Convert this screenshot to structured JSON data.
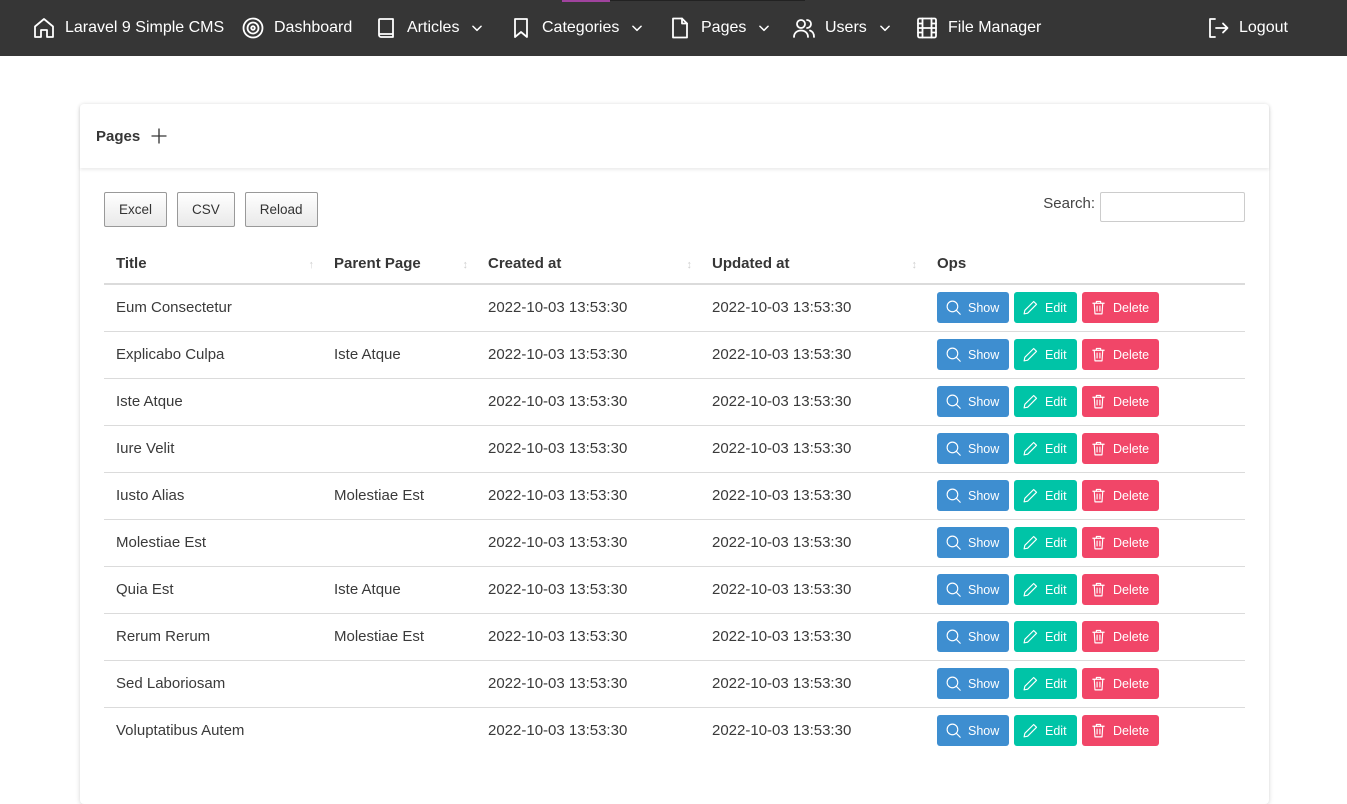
{
  "navbar": {
    "brand": "Laravel 9 Simple CMS",
    "items": [
      {
        "label": "Dashboard",
        "icon": "target-icon",
        "dropdown": false
      },
      {
        "label": "Articles",
        "icon": "book-icon",
        "dropdown": true
      },
      {
        "label": "Categories",
        "icon": "bookmark-icon",
        "dropdown": true
      },
      {
        "label": "Pages",
        "icon": "file-icon",
        "dropdown": true
      },
      {
        "label": "Users",
        "icon": "users-icon",
        "dropdown": true
      },
      {
        "label": "File Manager",
        "icon": "film-icon",
        "dropdown": false
      }
    ],
    "logout": "Logout",
    "bg_color": "#363636",
    "accent_color": "#a0439e"
  },
  "card": {
    "title": "Pages",
    "add_icon": "plus-icon"
  },
  "toolbar": {
    "excel": "Excel",
    "csv": "CSV",
    "reload": "Reload"
  },
  "search": {
    "label": "Search:",
    "value": "",
    "placeholder": ""
  },
  "table": {
    "columns": [
      "Title",
      "Parent Page",
      "Created at",
      "Updated at",
      "Ops"
    ],
    "rows": [
      {
        "title": "Eum Consectetur",
        "parent": "",
        "created": "2022-10-03 13:53:30",
        "updated": "2022-10-03 13:53:30"
      },
      {
        "title": "Explicabo Culpa",
        "parent": "Iste Atque",
        "created": "2022-10-03 13:53:30",
        "updated": "2022-10-03 13:53:30"
      },
      {
        "title": "Iste Atque",
        "parent": "",
        "created": "2022-10-03 13:53:30",
        "updated": "2022-10-03 13:53:30"
      },
      {
        "title": "Iure Velit",
        "parent": "",
        "created": "2022-10-03 13:53:30",
        "updated": "2022-10-03 13:53:30"
      },
      {
        "title": "Iusto Alias",
        "parent": "Molestiae Est",
        "created": "2022-10-03 13:53:30",
        "updated": "2022-10-03 13:53:30"
      },
      {
        "title": "Molestiae Est",
        "parent": "",
        "created": "2022-10-03 13:53:30",
        "updated": "2022-10-03 13:53:30"
      },
      {
        "title": "Quia Est",
        "parent": "Iste Atque",
        "created": "2022-10-03 13:53:30",
        "updated": "2022-10-03 13:53:30"
      },
      {
        "title": "Rerum Rerum",
        "parent": "Molestiae Est",
        "created": "2022-10-03 13:53:30",
        "updated": "2022-10-03 13:53:30"
      },
      {
        "title": "Sed Laboriosam",
        "parent": "",
        "created": "2022-10-03 13:53:30",
        "updated": "2022-10-03 13:53:30"
      },
      {
        "title": "Voluptatibus Autem",
        "parent": "",
        "created": "2022-10-03 13:53:30",
        "updated": "2022-10-03 13:53:30"
      }
    ],
    "ops": {
      "show": "Show",
      "edit": "Edit",
      "delete": "Delete",
      "show_color": "#3e8ed0",
      "edit_color": "#00c4a7",
      "delete_color": "#f14668"
    }
  }
}
